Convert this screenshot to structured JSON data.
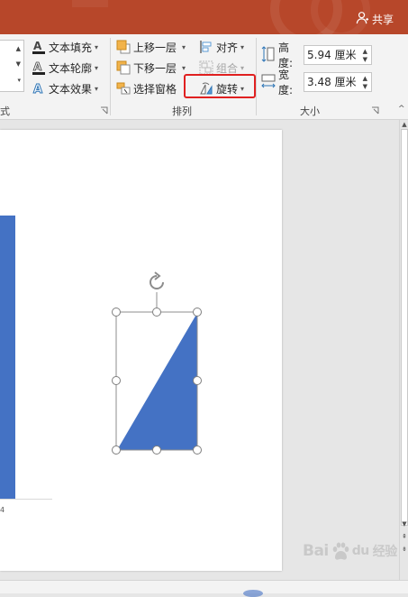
{
  "titlebar": {
    "share_label": "共享",
    "color": "#b7472a"
  },
  "ribbon": {
    "text_group": {
      "fill_label": "文本填充",
      "outline_label": "文本轮廓",
      "effect_label": "文本效果",
      "group_title_fragment": "式"
    },
    "arrange_group": {
      "bring_forward_label": "上移一层",
      "send_backward_label": "下移一层",
      "selection_pane_label": "选择窗格",
      "align_label": "对齐",
      "group_label": "组合",
      "rotate_label": "旋转",
      "title": "排列"
    },
    "size_group": {
      "height_label": "高度:",
      "height_value": "5.94 厘米",
      "width_label": "宽度:",
      "width_value": "3.48 厘米",
      "title": "大小"
    }
  },
  "slide": {
    "axis_tick_label": "4",
    "bar_color": "#4472c4",
    "shape_color": "#4472c4"
  },
  "watermark": {
    "text": "Bai",
    "suffix": "经验",
    "sub": "du"
  },
  "accent_colors": {
    "highlight": "#e02020"
  }
}
